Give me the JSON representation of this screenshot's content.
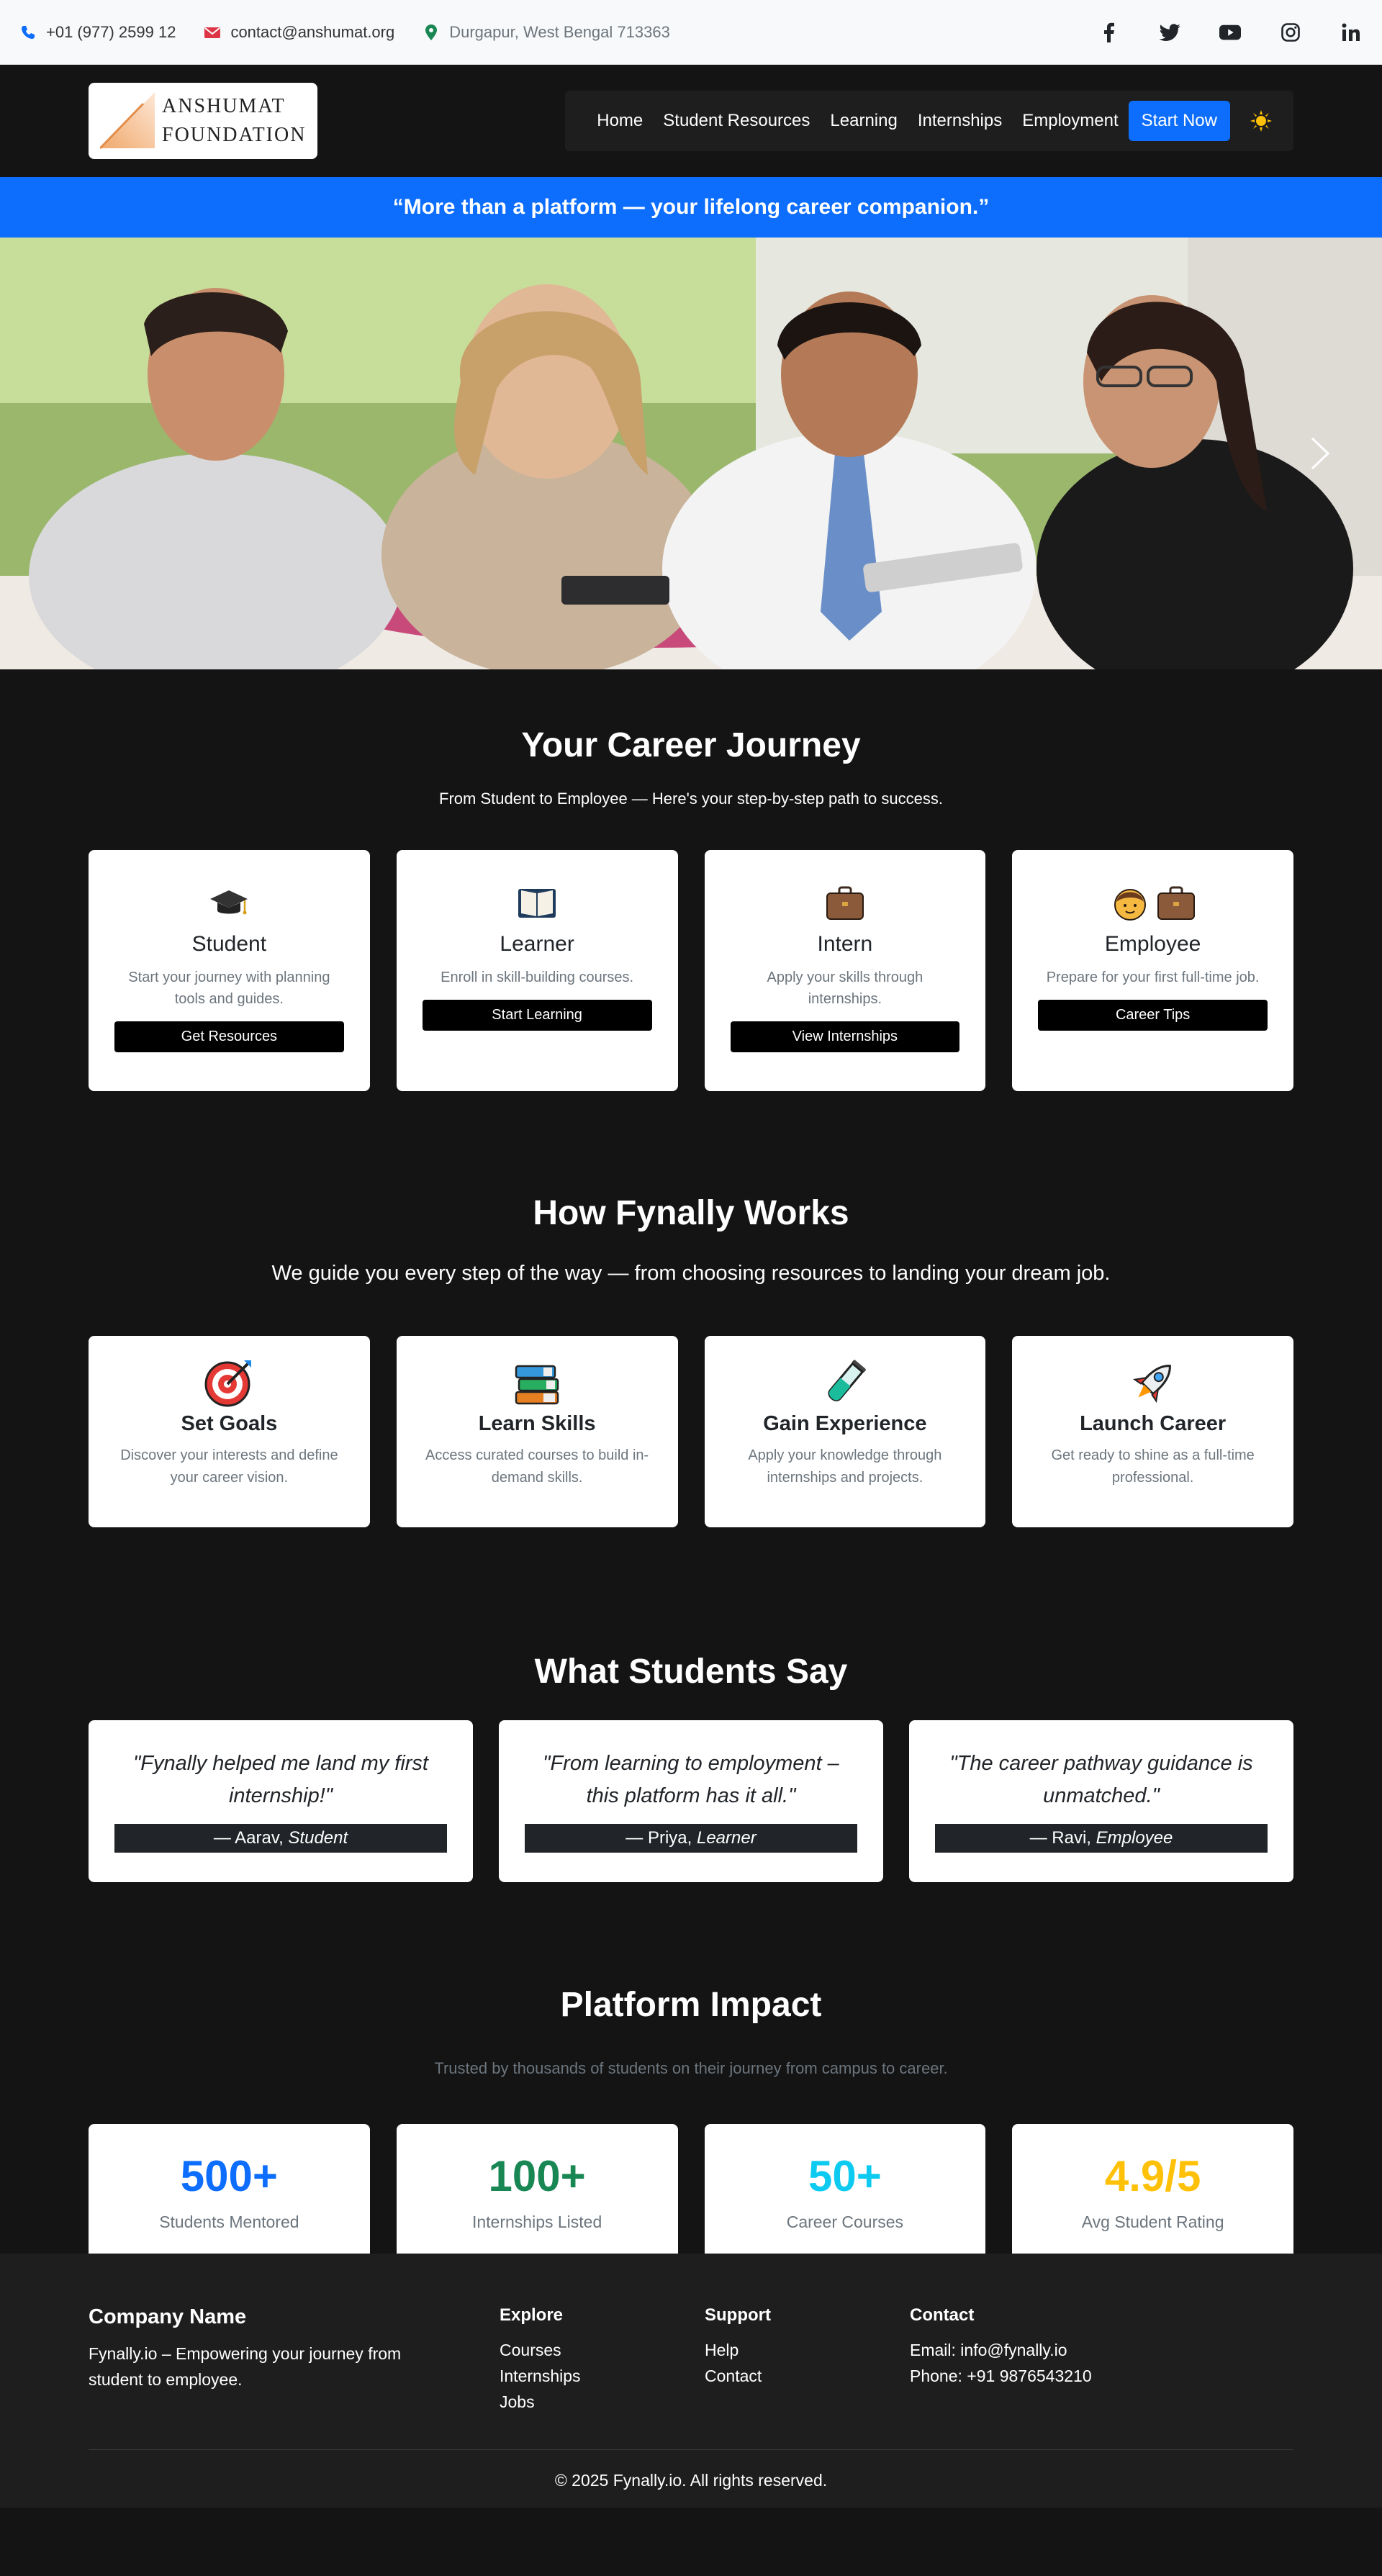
{
  "topbar": {
    "phone": "+01 (977) 2599 12",
    "email": "contact@anshumat.org",
    "address": "Durgapur, West Bengal 713363",
    "icons": [
      "phone-icon",
      "envelope-icon",
      "map-pin-icon"
    ],
    "socials": [
      "facebook-icon",
      "twitter-icon",
      "youtube-icon",
      "instagram-icon",
      "linkedin-icon"
    ]
  },
  "header": {
    "logo_line1": "ANSHUMAT",
    "logo_line2": "FOUNDATION",
    "nav": [
      "Home",
      "Student Resources",
      "Learning",
      "Internships",
      "Employment"
    ],
    "cta": "Start Now",
    "theme_icon": "sun-icon",
    "accent": "#0d6efd"
  },
  "banner": {
    "quote": "“More than a platform — your lifelong career companion.”"
  },
  "hero": {
    "next_icon": "chevron-right-icon"
  },
  "journey": {
    "title": "Your Career Journey",
    "subtitle": "From Student to Employee — Here's your step-by-step path to success.",
    "cards": [
      {
        "icon": "graduation-cap-icon",
        "title": "Student",
        "text": "Start your journey with planning tools and guides.",
        "button": "Get Resources"
      },
      {
        "icon": "open-book-icon",
        "title": "Learner",
        "text": "Enroll in skill-building courses.",
        "button": "Start Learning"
      },
      {
        "icon": "briefcase-icon",
        "title": "Intern",
        "text": "Apply your skills through internships.",
        "button": "View Internships"
      },
      {
        "icon": "person-briefcase-icon",
        "title": "Employee",
        "text": "Prepare for your first full-time job.",
        "button": "Career Tips"
      }
    ]
  },
  "works": {
    "title": "How Fynally Works",
    "subtitle": "We guide you every step of the way — from choosing resources to landing your dream job.",
    "cards": [
      {
        "icon": "target-icon",
        "title": "Set Goals",
        "text": "Discover your interests and define your career vision."
      },
      {
        "icon": "books-icon",
        "title": "Learn Skills",
        "text": "Access curated courses to build in-demand skills."
      },
      {
        "icon": "test-tube-icon",
        "title": "Gain Experience",
        "text": "Apply your knowledge through internships and projects."
      },
      {
        "icon": "rocket-icon",
        "title": "Launch Career",
        "text": "Get ready to shine as a full-time professional."
      }
    ]
  },
  "says": {
    "title": "What Students Say",
    "testimonials": [
      {
        "quote": "\"Fynally helped me land my first internship!\"",
        "name": "— Aarav, ",
        "role": "Student"
      },
      {
        "quote": "\"From learning to employment – this platform has it all.\"",
        "name": "— Priya, ",
        "role": "Learner"
      },
      {
        "quote": "\"The career pathway guidance is unmatched.\"",
        "name": "— Ravi, ",
        "role": "Employee"
      }
    ]
  },
  "impact": {
    "title": "Platform Impact",
    "subtitle": "Trusted by thousands of students on their journey from campus to career.",
    "stats": [
      {
        "value": "500+",
        "label": "Students Mentored",
        "color": "#0d6efd"
      },
      {
        "value": "100+",
        "label": "Internships Listed",
        "color": "#198754"
      },
      {
        "value": "50+",
        "label": "Career Courses",
        "color": "#0dcaf0"
      },
      {
        "value": "4.9/5",
        "label": "Avg Student Rating",
        "color": "#ffc107"
      }
    ]
  },
  "footer": {
    "company": "Company Name",
    "about": "Fynally.io – Empowering your journey from student to employee.",
    "explore_title": "Explore",
    "explore": [
      "Courses",
      "Internships",
      "Jobs"
    ],
    "support_title": "Support",
    "support": [
      "Help",
      "Contact"
    ],
    "contact_title": "Contact",
    "contact": [
      "Email: info@fynally.io",
      "Phone: +91 9876543210"
    ],
    "copyright": "© 2025 Fynally.io. All rights reserved."
  }
}
